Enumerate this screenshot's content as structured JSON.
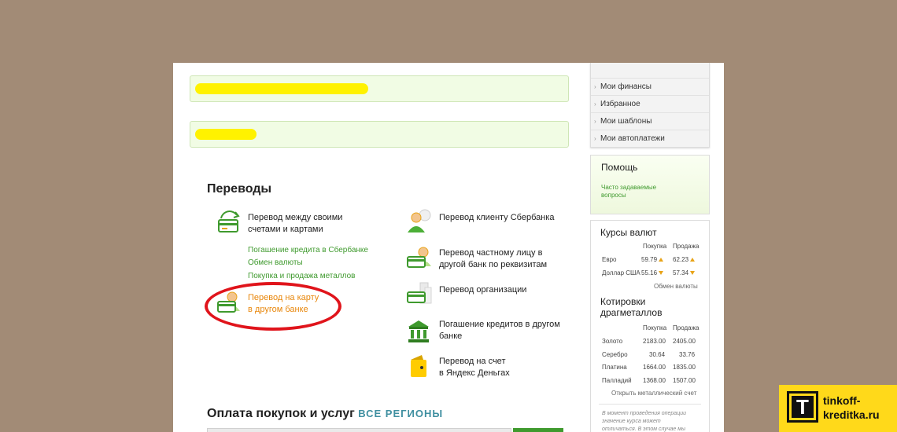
{
  "transfers": {
    "title": "Переводы",
    "left": [
      {
        "icon": "cards-transfer-icon",
        "lines": [
          "Перевод между своими",
          "счетами и картами"
        ]
      },
      {
        "icon": "card-person-icon",
        "lines": [
          "Перевод на карту",
          "в другом банке"
        ]
      }
    ],
    "sublinks": [
      "Погашение кредита в Сбербанке",
      "Обмен валюты",
      "Покупка и продажа металлов"
    ],
    "right": [
      {
        "icon": "person-sber-icon",
        "lines": [
          "Перевод клиенту Сбербанка",
          ""
        ]
      },
      {
        "icon": "card-person-icon",
        "lines": [
          "Перевод частному лицу в",
          "другой банк по реквизитам"
        ]
      },
      {
        "icon": "organization-icon",
        "lines": [
          "Перевод организации",
          ""
        ]
      },
      {
        "icon": "bank-building-icon",
        "lines": [
          "Погашение кредитов в другом",
          "банке"
        ]
      },
      {
        "icon": "yandex-wallet-icon",
        "lines": [
          "Перевод на счет",
          "в Яндекс Деньгах"
        ]
      }
    ]
  },
  "payments": {
    "title": "Оплата покупок и услуг",
    "regions": "ВСЕ РЕГИОНЫ"
  },
  "sidebar": {
    "menu": [
      {
        "label": "Мои финансы"
      },
      {
        "label": "Избранное"
      },
      {
        "label": "Мои шаблоны"
      },
      {
        "label": "Мои автоплатежи"
      }
    ],
    "help": {
      "title": "Помощь",
      "faq": [
        "Часто задаваемые",
        "вопросы"
      ]
    },
    "rates": {
      "title": "Курсы валют",
      "headers": [
        "Покупка",
        "Продажа"
      ],
      "rows": [
        {
          "name": "Евро",
          "buy": "59.79",
          "sell": "62.23",
          "trend_buy": "up",
          "trend_sell": "up"
        },
        {
          "name": "Доллар США",
          "buy": "55.16",
          "sell": "57.34",
          "trend_buy": "down",
          "trend_sell": "down"
        }
      ],
      "link": "Обмен валюты"
    },
    "metals": {
      "title": [
        "Котировки",
        "драгметаллов"
      ],
      "headers": [
        "Покупка",
        "Продажа"
      ],
      "rows": [
        {
          "name": "Золото",
          "buy": "2183.00",
          "sell": "2405.00"
        },
        {
          "name": "Серебро",
          "buy": "30.64",
          "sell": "33.76"
        },
        {
          "name": "Платина",
          "buy": "1664.00",
          "sell": "1835.00"
        },
        {
          "name": "Палладий",
          "buy": "1368.00",
          "sell": "1507.00"
        }
      ],
      "link": "Открыть металлический счет"
    },
    "note": [
      "В момент проведения операции",
      "значение курса может",
      "отличаться. В этом случае мы"
    ]
  },
  "watermark": {
    "letter": "T",
    "lines": [
      "tinkoff-",
      "kreditka.ru"
    ]
  },
  "colors": {
    "background": "#a28b76",
    "green": "#3f9a2e",
    "highlight": "#e8870c",
    "circle": "#e0141b",
    "logo": "#ffd91a"
  }
}
